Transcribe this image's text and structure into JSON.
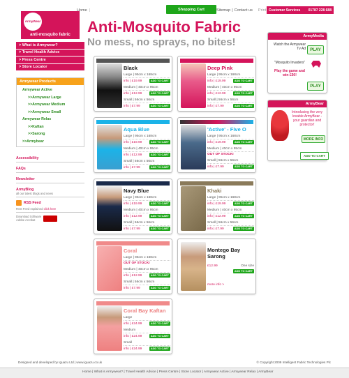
{
  "topnav": {
    "home": "Home"
  },
  "cart_label": "Shopping Cart",
  "rightnav": {
    "sitemap": "Sitemap",
    "contact": "Contact us",
    "print": "Print"
  },
  "custserv": {
    "label": "Customer Services",
    "phone": "01787 228 688"
  },
  "logo": {
    "brand": "ArmyWear",
    "tag": "anti-mosquito fabric"
  },
  "leftnav": [
    "> What is Armywear?",
    "> Travel Health Advice",
    "> Press Centre",
    "> Store Locator"
  ],
  "products_menu": {
    "header": "Armywear Products",
    "links": [
      "Armywear Active",
      ">>Armywear Large",
      ">>Armywear Medium",
      ">>Armywear Small",
      "Armywear Relax",
      ">>Kaftan",
      ">>Sarong",
      ">>Armybear"
    ]
  },
  "side_links": {
    "accessibility": "Accessibility",
    "faqs": "FAQs",
    "newsletter": "Newsletter",
    "blog": "ArmyBlog",
    "blog_sub": "all our latest blogs and news",
    "rss": "RSS Feed",
    "rss_explained": "RSS Feed explained ",
    "click_here": "click here",
    "download": "Download Software",
    "adobe": "Adobe Acrobat"
  },
  "title": "Anti-Mosquito Fabric",
  "subtitle": "No mess, no sprays, no bites!",
  "add_to_cart": "ADD TO CART",
  "products": [
    {
      "name": "Black",
      "rows": [
        {
          "size": "Large | 95cm x 168cm",
          "price": "info | £19.99"
        },
        {
          "size": "Medium | 40cm x 95cm",
          "price": "info | £12.99"
        },
        {
          "size": "Small | 56cm x 56cm",
          "price": "info | £7.99"
        }
      ]
    },
    {
      "name": "Deep Pink",
      "rows": [
        {
          "size": "Large | 95cm x 168cm",
          "price": "info | £19.99"
        },
        {
          "size": "Medium | 40cm x 95cm",
          "price": "info | £12.99"
        },
        {
          "size": "Small | 56cm x 56cm",
          "price": "info | £7.99"
        }
      ]
    },
    {
      "name": "Aqua Blue",
      "rows": [
        {
          "size": "Large | 95cm x 168cm",
          "price": "info | £19.99"
        },
        {
          "size": "Medium | 40cm x 95cm",
          "price": "info | £12.99"
        },
        {
          "size": "Small | 56cm x 56cm",
          "price": "info | £7.99"
        }
      ]
    },
    {
      "name": "'Active' - Five O",
      "rows": [
        {
          "size": "Large | 95cm x 168cm",
          "price": "info | £19.99"
        },
        {
          "size": "Medium | 40cm x 95cm",
          "price": "OUT OF STOCK!"
        },
        {
          "size": "Small | 56cm x 56cm",
          "price": "info | £7.99"
        }
      ]
    },
    {
      "name": "Navy Blue",
      "rows": [
        {
          "size": "Large | 95cm x 168cm",
          "price": "info | £19.99"
        },
        {
          "size": "Medium | 40cm x 95cm",
          "price": "info | £12.99"
        },
        {
          "size": "Small | 56cm x 56cm",
          "price": "info | £7.99"
        }
      ]
    },
    {
      "name": "Khaki",
      "rows": [
        {
          "size": "Large | 95cm x 168cm",
          "price": "info | £19.99"
        },
        {
          "size": "Medium | 40cm x 95cm",
          "price": "info | £12.99"
        },
        {
          "size": "Small | 56cm x 56cm",
          "price": "info | £7.99"
        }
      ]
    },
    {
      "name": "Coral",
      "rows": [
        {
          "size": "Large | 95cm x 168cm",
          "price": "OUT OF STOCK!"
        },
        {
          "size": "Medium | 40cm x 95cm",
          "price": "info | £12.99"
        },
        {
          "size": "Small | 56cm x 56cm",
          "price": "info | £7.99"
        }
      ]
    },
    {
      "name": "Montego Bay Sarong",
      "price": "£12.99",
      "one_size": "One size",
      "more": "more info >"
    },
    {
      "name": "Coral Bay Kaftan",
      "rows": [
        {
          "size": "Large",
          "price": "info | £24.99"
        },
        {
          "size": "Medium",
          "price": "info | £24.99"
        },
        {
          "size": "Small",
          "price": "info | £24.99"
        }
      ]
    }
  ],
  "armymedia": {
    "header": "ArmyMedia",
    "text1": "Watch the Armywear Tv Ad",
    "play": "PLAY",
    "text2": "\"Mosquito Invaders\"",
    "text3": "Play the game and win £50!"
  },
  "armybear": {
    "header": "ArmyBear",
    "text": "Introducing the very lovable ArmyBear - your guardian and protector!",
    "more_info": "MORE INFO"
  },
  "footer": {
    "left": "Designed and developed by Iguazu Ltd | www.iguazu.co.uk",
    "right": "© Copyright 2009 Intelligent Fabric Technologies Plc"
  },
  "footlinks": "Home | What is Armywear? | Travel Health Advice | Press Centre | Store Locator | Armywear Active | Armywear Relax | ArmyBear",
  "colors": {
    "brand": "#d4145a",
    "green": "#1ea61a",
    "orange": "#f7a21b"
  }
}
